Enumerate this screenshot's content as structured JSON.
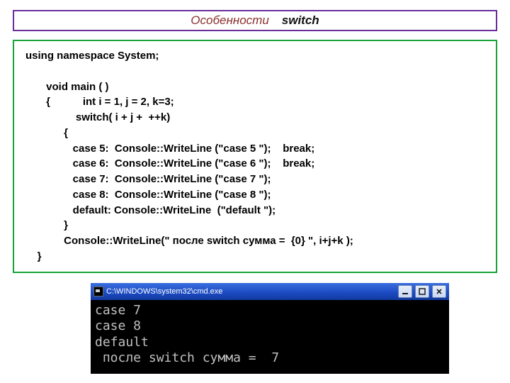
{
  "header": {
    "left": "Особенности",
    "right": "switch"
  },
  "code": "using namespace System;\n\n       void main ( )\n       {           int i = 1, j = 2, k=3;\n                 switch( i + j +  ++k)\n             {\n                case 5:  Console::WriteLine (\"case 5 \");    break;\n                case 6:  Console::WriteLine (\"case 6 \");    break;\n                case 7:  Console::WriteLine (\"case 7 \");\n                case 8:  Console::WriteLine (\"case 8 \");\n                default: Console::WriteLine  (\"default \");\n             }\n             Console::WriteLine(\" после switch сумма =  {0} \", i+j+k );\n    }",
  "console": {
    "title": "C:\\WINDOWS\\system32\\cmd.exe",
    "lines": [
      "case 7",
      "case 8",
      "default",
      " после switch сумма =  7"
    ]
  }
}
